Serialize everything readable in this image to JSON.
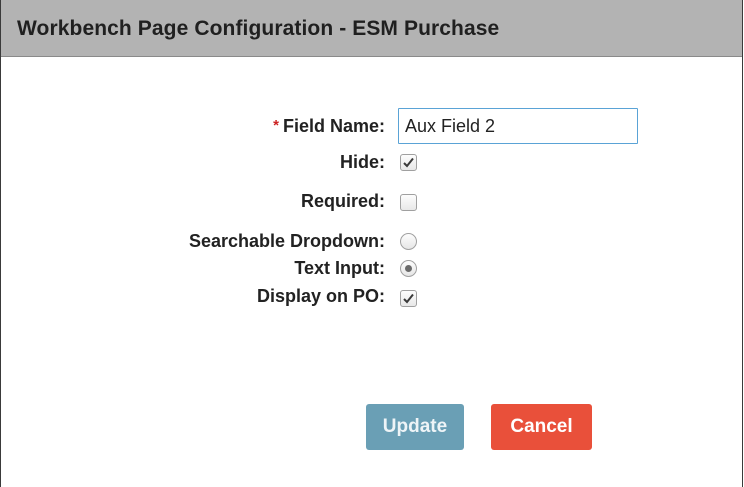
{
  "dialog": {
    "title": "Workbench Page Configuration - ESM Purchase"
  },
  "form": {
    "field_name": {
      "required_marker": "*",
      "label": "Field Name:",
      "value": "Aux Field 2"
    },
    "hide": {
      "label": "Hide:",
      "checked": true
    },
    "required": {
      "label": "Required:",
      "checked": false
    },
    "searchable_dropdown": {
      "label": "Searchable Dropdown:",
      "selected": false
    },
    "text_input": {
      "label": "Text Input:",
      "selected": true
    },
    "display_on_po": {
      "label": "Display on PO:",
      "checked": true
    }
  },
  "buttons": {
    "update_label": "Update",
    "cancel_label": "Cancel"
  },
  "colors": {
    "titlebar": "#b3b3b3",
    "update_button": "#6a9fb5",
    "cancel_button": "#e9503a",
    "required_star": "#cc2222",
    "input_border": "#5aa3d6"
  },
  "icons": {
    "checkbox_checked": "checkmark-icon",
    "radio_selected": "radio-dot-icon"
  }
}
